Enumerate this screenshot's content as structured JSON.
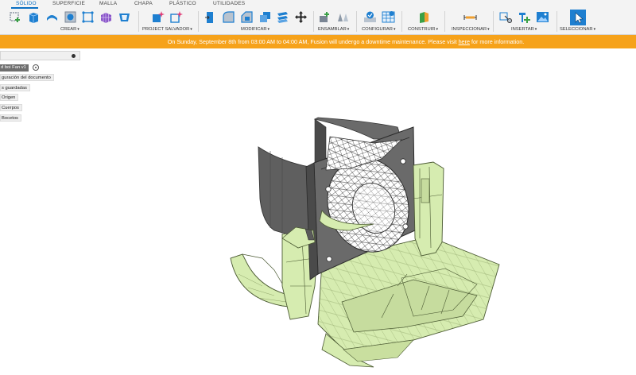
{
  "ribbon": {
    "tabs": [
      {
        "label": "SÓLIDO",
        "active": true
      },
      {
        "label": "SUPERFICIE",
        "active": false
      },
      {
        "label": "MALLA",
        "active": false
      },
      {
        "label": "CHAPA",
        "active": false
      },
      {
        "label": "PLÁSTICO",
        "active": false
      },
      {
        "label": "UTILIDADES",
        "active": false
      }
    ]
  },
  "toolbar": {
    "groups": [
      {
        "label": "CREAR",
        "icons": [
          "new-component-icon",
          "extrude-icon",
          "revolve-icon",
          "hole-icon",
          "pattern-icon",
          "form-icon",
          "shell-icon"
        ]
      },
      {
        "label": "PROJECT SALVADOR",
        "icons": [
          "add-in-icon",
          "sparkle-tool-icon"
        ]
      },
      {
        "label": "MODIFICAR",
        "icons": [
          "press-pull-icon",
          "fillet-icon",
          "chamfer-icon",
          "shell-modify-icon",
          "combine-icon",
          "move-icon"
        ]
      },
      {
        "label": "ENSAMBLAR",
        "icons": [
          "new-joint-icon",
          "joint-icon"
        ]
      },
      {
        "label": "CONFIGURAR",
        "icons": [
          "configure-icon",
          "table-icon"
        ]
      },
      {
        "label": "CONSTRUIR",
        "icons": [
          "plane-icon"
        ]
      },
      {
        "label": "INSPECCIONAR",
        "icons": [
          "measure-icon"
        ]
      },
      {
        "label": "INSERTAR",
        "icons": [
          "insert-derive-icon",
          "insert-component-icon",
          "insert-image-icon"
        ]
      },
      {
        "label": "SELECCIONAR",
        "icons": [
          "select-cursor-icon"
        ]
      }
    ],
    "colors": {
      "blue": "#1e7fd0",
      "purple": "#8a56c9",
      "green": "#3aa046",
      "gray": "#7a8594"
    }
  },
  "banner": {
    "text_before": "On Sunday, September 8th from 03:00 AM to 04:00 AM, Fusion will undergo a downtime maintenance. Please visit ",
    "link": "here",
    "text_after": " for more information.",
    "color": "#f6a21a"
  },
  "browser": {
    "root": "d boi Fan v1",
    "items": [
      "guración del documento",
      "s guardadas",
      "Origen",
      "Cuerpos",
      "Bocetos"
    ]
  },
  "viewport": {
    "model_colors": {
      "printed_part": "#d6ecb0",
      "edges": "#4b5a33",
      "fan": "#6a6a6a",
      "fan_dark": "#4a4a4a"
    }
  }
}
